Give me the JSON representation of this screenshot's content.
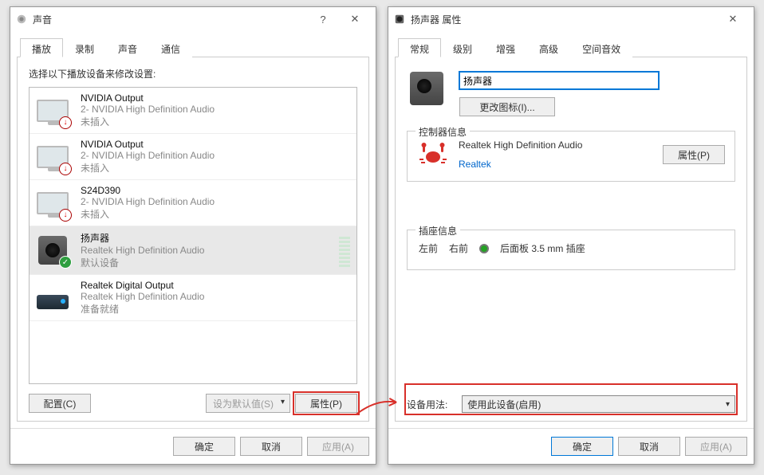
{
  "win1": {
    "title": "声音",
    "tabs": [
      "播放",
      "录制",
      "声音",
      "通信"
    ],
    "active_tab": 0,
    "instruction": "选择以下播放设备来修改设置:",
    "devices": [
      {
        "name": "NVIDIA Output",
        "sub": "2- NVIDIA High Definition Audio",
        "status": "未插入",
        "icon": "monitor",
        "badge": "red"
      },
      {
        "name": "NVIDIA Output",
        "sub": "2- NVIDIA High Definition Audio",
        "status": "未插入",
        "icon": "monitor",
        "badge": "red"
      },
      {
        "name": "S24D390",
        "sub": "2- NVIDIA High Definition Audio",
        "status": "未插入",
        "icon": "monitor",
        "badge": "red"
      },
      {
        "name": "扬声器",
        "sub": "Realtek High Definition Audio",
        "status": "默认设备",
        "icon": "speaker",
        "badge": "green",
        "selected": true,
        "meter": true
      },
      {
        "name": "Realtek Digital Output",
        "sub": "Realtek High Definition Audio",
        "status": "准备就绪",
        "icon": "amp",
        "badge": ""
      }
    ],
    "buttons": {
      "configure": "配置(C)",
      "setdefault": "设为默认值(S)",
      "properties": "属性(P)"
    },
    "footer": {
      "ok": "确定",
      "cancel": "取消",
      "apply": "应用(A)"
    }
  },
  "win2": {
    "title": "扬声器 属性",
    "tabs": [
      "常规",
      "级别",
      "增强",
      "高级",
      "空间音效"
    ],
    "active_tab": 0,
    "device_name_value": "扬声器",
    "change_icon_btn": "更改图标(I)...",
    "controller_legend": "控制器信息",
    "controller_name": "Realtek High Definition Audio",
    "controller_vendor": "Realtek",
    "controller_props_btn": "属性(P)",
    "jack_legend": "插座信息",
    "jack_l": "左前",
    "jack_r": "右前",
    "jack_desc": "后面板 3.5 mm 插座",
    "usage_label": "设备用法:",
    "usage_value": "使用此设备(启用)",
    "footer": {
      "ok": "确定",
      "cancel": "取消",
      "apply": "应用(A)"
    }
  }
}
